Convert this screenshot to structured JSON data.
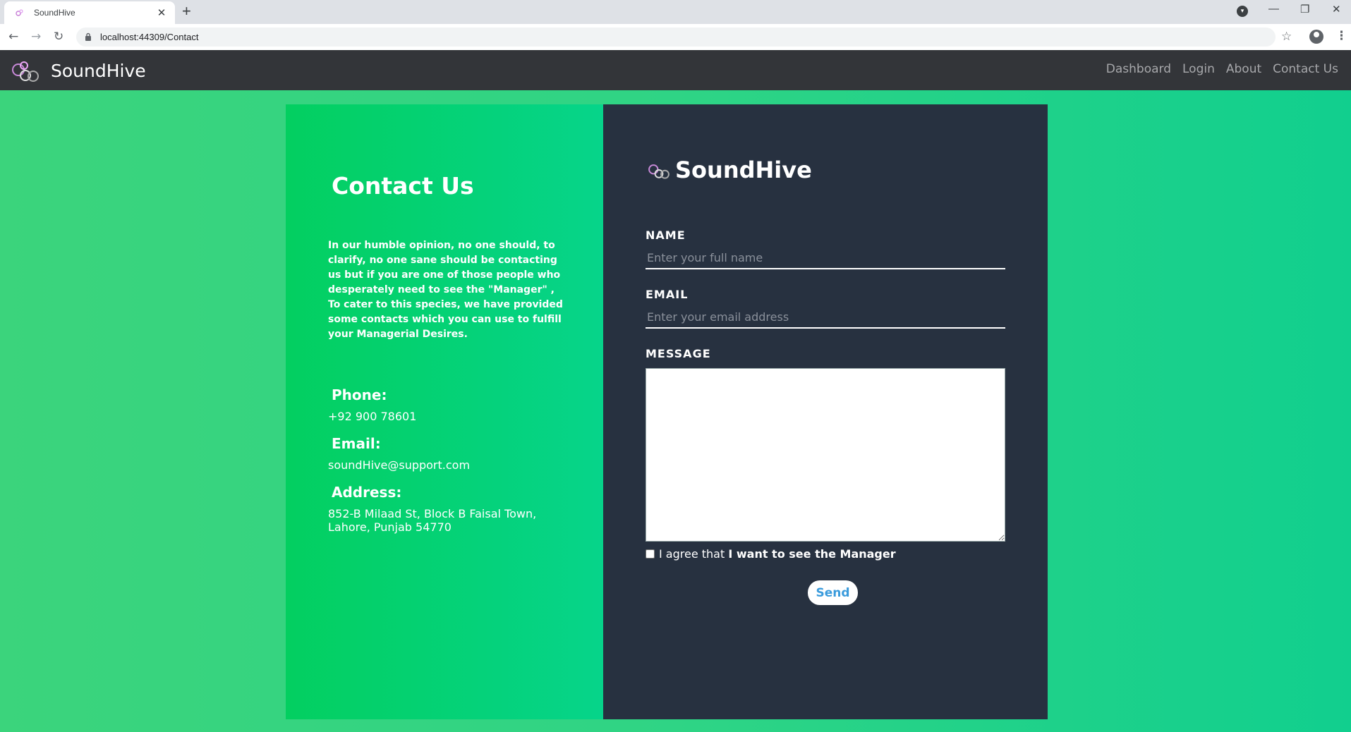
{
  "browser": {
    "tab_title": "SoundHive",
    "tab_close": "✕",
    "new_tab": "+",
    "url": "localhost:44309/Contact",
    "window_minimize": "—",
    "window_restore": "❐",
    "window_close": "✕"
  },
  "navbar": {
    "brand": "SoundHive",
    "links": [
      "Dashboard",
      "Login",
      "About",
      "Contact Us"
    ]
  },
  "contact": {
    "title": "Contact Us",
    "intro": "In our humble opinion, no one should, to clarify, no one sane should be contacting us but if you are one of those people who desperately need to see the \"Manager\" , To cater to this species, we have provided some contacts which you can use to fulfill your Managerial Desires.",
    "phone_label": "Phone:",
    "phone": "+92 900 78601",
    "email_label": "Email:",
    "email": "soundHive@support.com",
    "address_label": "Address:",
    "address": "852-B Milaad St, Block B Faisal Town, Lahore, Punjab 54770"
  },
  "form": {
    "brand": "SoundHive",
    "name_label": "NAME",
    "name_placeholder": "Enter your full name",
    "email_label": "EMAIL",
    "email_placeholder": "Enter your email address",
    "message_label": "MESSAGE",
    "agree_prefix": "I agree that ",
    "agree_bold": "I want to see the Manager",
    "send_label": "Send"
  },
  "colors": {
    "navbar_bg": "#333539",
    "form_bg": "#273140",
    "accent_green": "#03cf60",
    "send_text": "#3a9bdc"
  }
}
